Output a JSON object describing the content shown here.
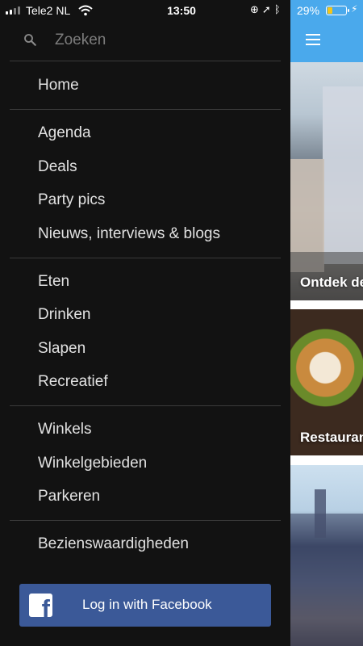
{
  "status_bar": {
    "carrier": "Tele2 NL",
    "time": "13:50",
    "battery_percent": "29%",
    "battery_level": 0.29,
    "icons": [
      "signal-icon",
      "wifi-icon",
      "orientation-lock-icon",
      "location-icon",
      "bluetooth-icon",
      "charging-icon"
    ]
  },
  "drawer": {
    "search": {
      "placeholder": "Zoeken"
    },
    "sections": [
      {
        "items": [
          {
            "label": "Home"
          }
        ]
      },
      {
        "items": [
          {
            "label": "Agenda"
          },
          {
            "label": "Deals"
          },
          {
            "label": "Party pics"
          },
          {
            "label": "Nieuws, interviews & blogs"
          }
        ]
      },
      {
        "items": [
          {
            "label": "Eten"
          },
          {
            "label": "Drinken"
          },
          {
            "label": "Slapen"
          },
          {
            "label": "Recreatief"
          }
        ]
      },
      {
        "items": [
          {
            "label": "Winkels"
          },
          {
            "label": "Winkelgebieden"
          },
          {
            "label": "Parkeren"
          }
        ]
      },
      {
        "items": [
          {
            "label": "Bezienswaardigheden"
          }
        ]
      }
    ],
    "facebook_button": {
      "label": "Log in with Facebook",
      "icon": "facebook-icon"
    }
  },
  "main": {
    "header": {
      "menu_icon": "hamburger-menu-icon",
      "color": "#4aa9ec"
    },
    "cards": [
      {
        "title": "Ontdek de"
      },
      {
        "title": "Restauran"
      },
      {
        "title": ""
      }
    ]
  },
  "colors": {
    "drawer_background": "#121212",
    "divider": "#3a3a3a",
    "facebook_blue": "#3b5998",
    "header_blue": "#4aa9ec",
    "battery_fill": "#f5c518"
  }
}
